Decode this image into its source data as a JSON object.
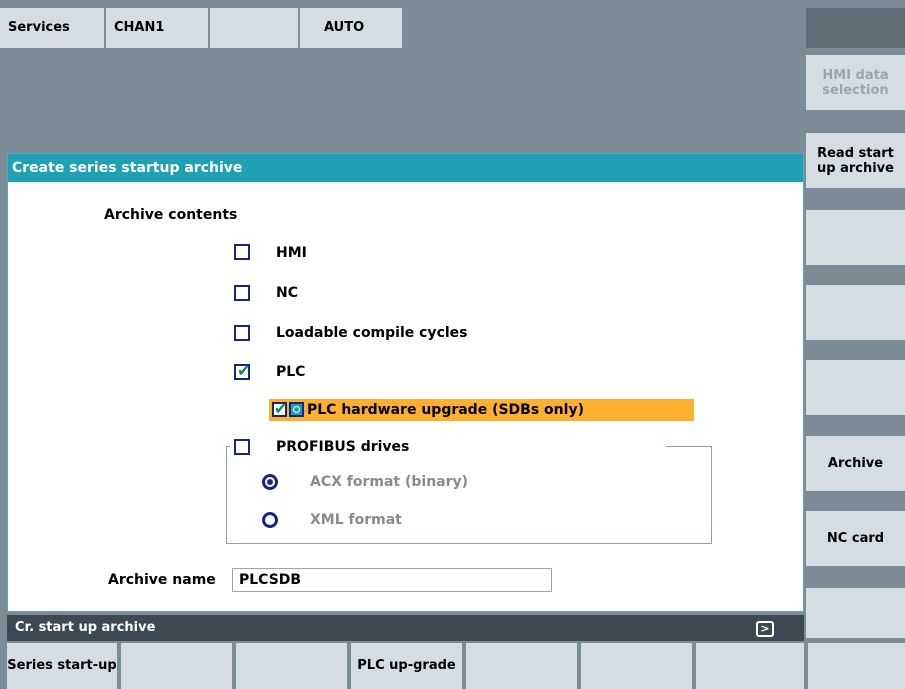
{
  "header": {
    "area": "Services",
    "channel": "CHAN1",
    "mode": "AUTO"
  },
  "dialog": {
    "title": "Create series startup archive",
    "contents_heading": "Archive contents",
    "items": {
      "hmi": {
        "label": "HMI",
        "checked": false
      },
      "nc": {
        "label": "NC",
        "checked": false
      },
      "compile_cycles": {
        "label": "Loadable compile cycles",
        "checked": false
      },
      "plc": {
        "label": "PLC",
        "checked": true
      },
      "plc_hw_upgrade": {
        "label": "PLC hardware upgrade (SDBs only)",
        "checked": true
      },
      "profibus": {
        "label": "PROFIBUS drives",
        "checked": false
      }
    },
    "formats": {
      "acx": {
        "label": "ACX format (binary)",
        "selected": true
      },
      "xml": {
        "label": "XML format",
        "selected": false
      }
    },
    "archive_name_label": "Archive name",
    "archive_name_value": "PLCSDB"
  },
  "status": {
    "text": "Cr. start up archive",
    "next_icon": "chevron-right-icon"
  },
  "right_softkeys": {
    "sk1": "HMI data selection",
    "sk2": "Read start up archive",
    "sk3": "",
    "sk4": "",
    "sk5": "",
    "sk6": "Archive",
    "sk7": "NC card",
    "sk8": ""
  },
  "bottom_softkeys": {
    "sk1": "Series start-up",
    "sk2": "",
    "sk3": "",
    "sk4": "PLC up-grade",
    "sk5": "",
    "sk6": "",
    "sk7": ""
  },
  "colors": {
    "title_bar": "#1fa0b4",
    "highlight": "#fdb030",
    "softkey": "#d5dde3",
    "background": "#7b8c96"
  }
}
